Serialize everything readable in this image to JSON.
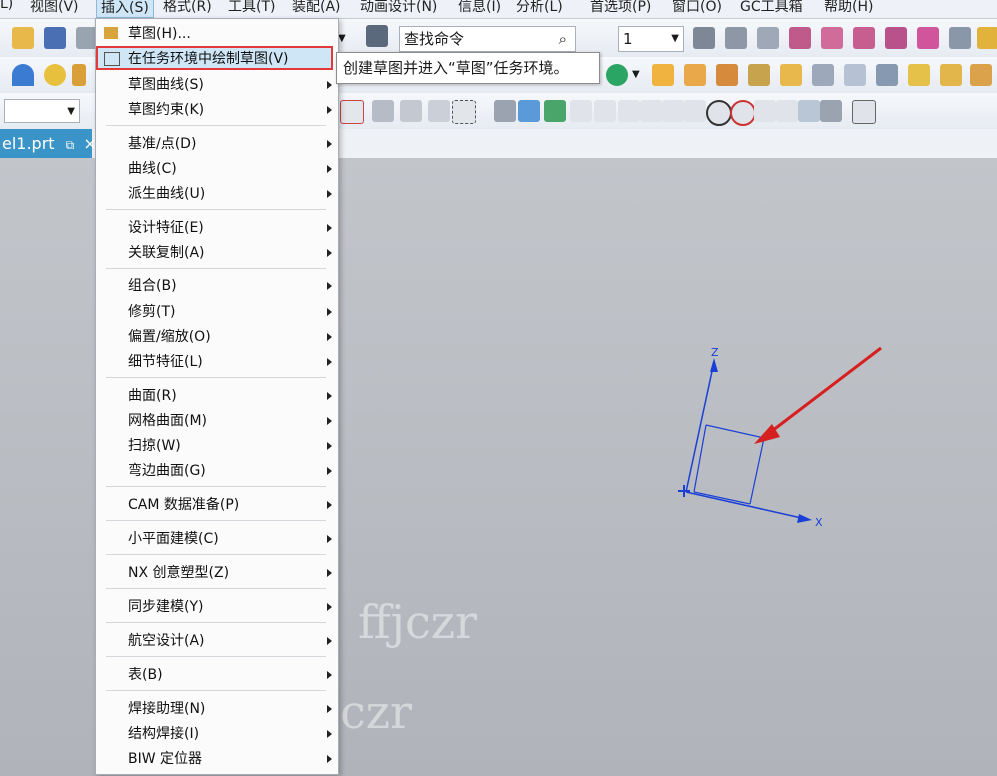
{
  "menubar": [
    {
      "label": "L)"
    },
    {
      "label": "视图(V)"
    },
    {
      "label": "插入(S)"
    },
    {
      "label": "格式(R)"
    },
    {
      "label": "工具(T)"
    },
    {
      "label": "装配(A)"
    },
    {
      "label": "动画设计(N)"
    },
    {
      "label": "信息(I)"
    },
    {
      "label": "分析(L)"
    },
    {
      "label": "首选项(P)"
    },
    {
      "label": "窗口(O)"
    },
    {
      "label": "GC工具箱"
    },
    {
      "label": "帮助(H)"
    }
  ],
  "toolbar": {
    "search_placeholder": "查找命令",
    "layer_value": "1"
  },
  "tab": {
    "label": "el1.prt",
    "close": "×"
  },
  "menu": {
    "items": [
      {
        "label": "草图(H)..."
      },
      {
        "label": "在任务环境中绘制草图(V)"
      },
      {
        "label": "草图曲线(S)"
      },
      {
        "label": "草图约束(K)"
      },
      {
        "label": "基准/点(D)"
      },
      {
        "label": "曲线(C)"
      },
      {
        "label": "派生曲线(U)"
      },
      {
        "label": "设计特征(E)"
      },
      {
        "label": "关联复制(A)"
      },
      {
        "label": "组合(B)"
      },
      {
        "label": "修剪(T)"
      },
      {
        "label": "偏置/缩放(O)"
      },
      {
        "label": "细节特征(L)"
      },
      {
        "label": "曲面(R)"
      },
      {
        "label": "网格曲面(M)"
      },
      {
        "label": "扫掠(W)"
      },
      {
        "label": "弯边曲面(G)"
      },
      {
        "label": "CAM 数据准备(P)"
      },
      {
        "label": "小平面建模(C)"
      },
      {
        "label": "NX 创意塑型(Z)"
      },
      {
        "label": "同步建模(Y)"
      },
      {
        "label": "航空设计(A)"
      },
      {
        "label": "表(B)"
      },
      {
        "label": "焊接助理(N)"
      },
      {
        "label": "结构焊接(I)"
      },
      {
        "label": "BIW 定位器"
      }
    ]
  },
  "tooltip": {
    "text": "创建草图并进入“草图”任务环境。"
  },
  "axes": {
    "z": "Z",
    "x": "X"
  },
  "watermark": {
    "text1": "百度ID：ffjczr",
    "text2": "百度ID：ffjczr"
  },
  "colors": {
    "highlight_border": "#e23a3a",
    "arrow": "#d62020",
    "axis": "#1a3fd6",
    "tab": "#3a94c7"
  }
}
